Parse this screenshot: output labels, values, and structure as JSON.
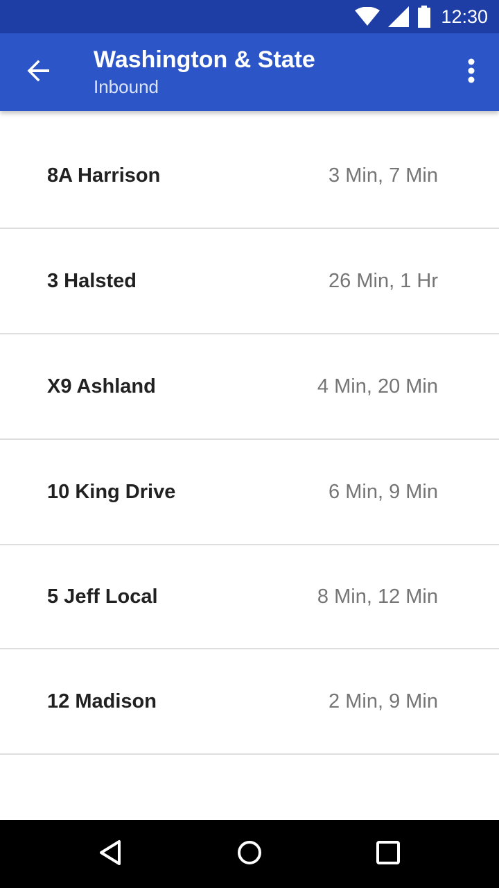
{
  "status_bar": {
    "time": "12:30",
    "icons": [
      "wifi-icon",
      "cell-signal-icon",
      "battery-icon"
    ]
  },
  "app_bar": {
    "title": "Washington & State",
    "subtitle": "Inbound",
    "back_icon": "arrow-back-icon",
    "overflow_icon": "more-vert-icon"
  },
  "routes": [
    {
      "name": "8A Harrison",
      "times": "3 Min, 7 Min"
    },
    {
      "name": "3 Halsted",
      "times": "26 Min, 1 Hr"
    },
    {
      "name": "X9 Ashland",
      "times": "4 Min, 20 Min"
    },
    {
      "name": "10 King Drive",
      "times": "6 Min, 9 Min"
    },
    {
      "name": "5 Jeff Local",
      "times": "8 Min, 12 Min"
    },
    {
      "name": "12 Madison",
      "times": "2 Min, 9 Min"
    }
  ],
  "nav_bar": {
    "buttons": [
      "back-triangle-icon",
      "home-circle-icon",
      "recents-square-icon"
    ]
  },
  "colors": {
    "status_bar": "#1e3ea6",
    "app_bar": "#2c56c7",
    "divider": "#dedede",
    "primary_text": "#212121",
    "secondary_text": "#757575"
  }
}
